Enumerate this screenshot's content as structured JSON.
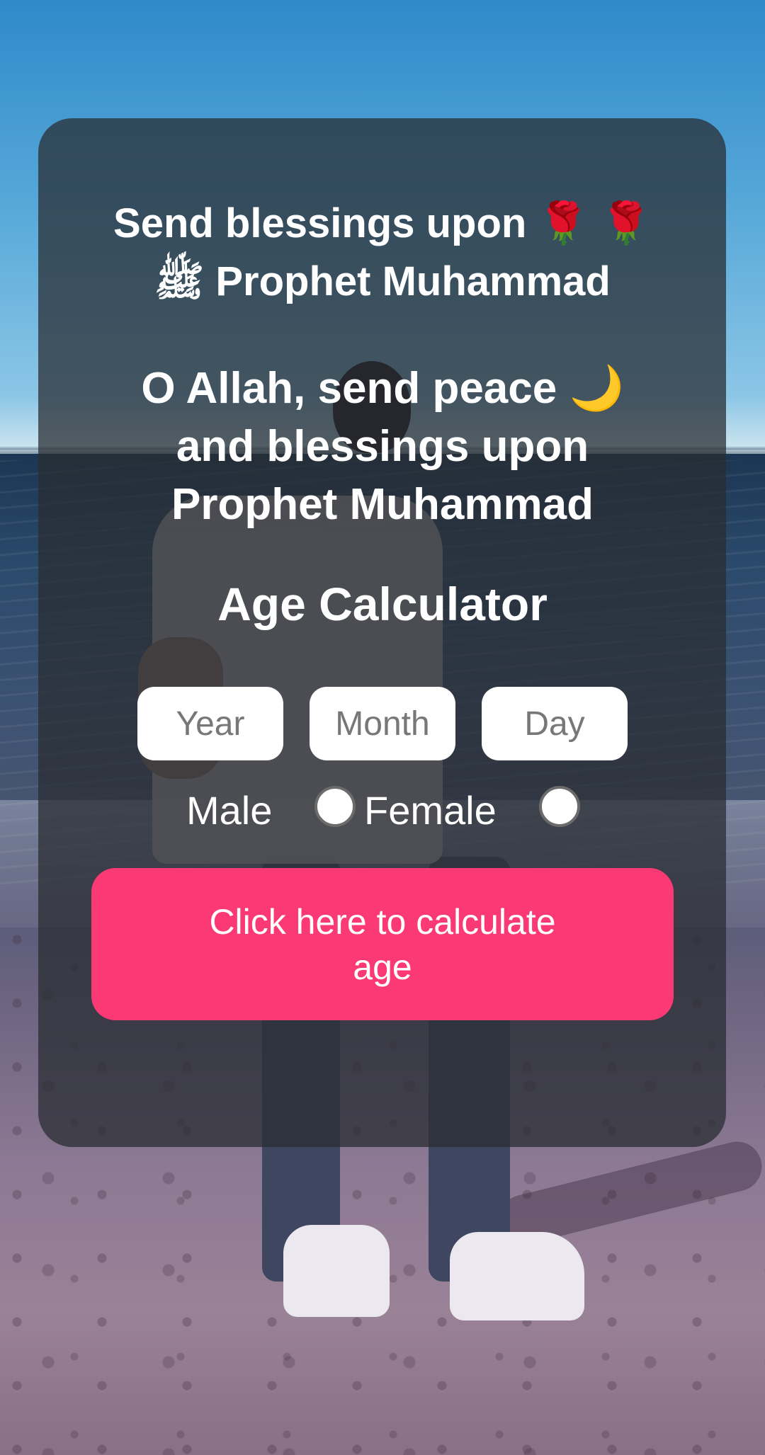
{
  "header": {
    "blessing_title": "Send blessings upon 🌹 🌹 ﷺ Prophet Muhammad",
    "prayer_text": "O Allah, send peace 🌙 and blessings upon Prophet Muhammad",
    "app_title": "Age Calculator"
  },
  "form": {
    "year_placeholder": "Year",
    "month_placeholder": "Month",
    "day_placeholder": "Day",
    "male_label": "Male",
    "female_label": "Female",
    "male_selected": false,
    "female_selected": false
  },
  "actions": {
    "calculate_label": "Click here to calculate age"
  },
  "colors": {
    "button": "#fb3a75",
    "card_overlay": "rgba(40,44,50,0.74)",
    "text": "#ffffff"
  }
}
